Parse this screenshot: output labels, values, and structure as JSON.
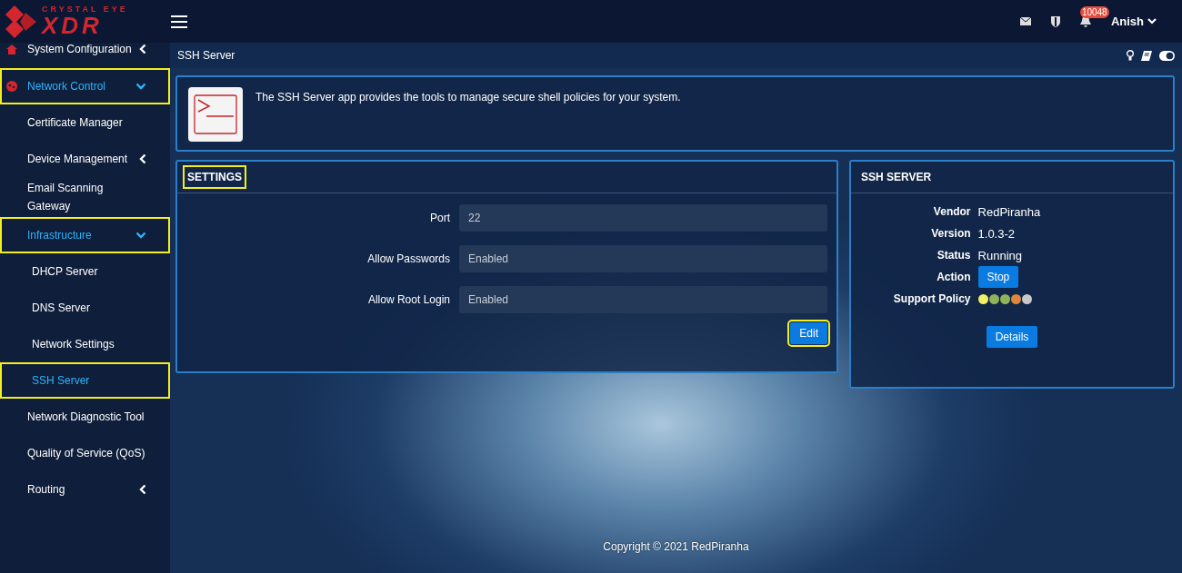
{
  "header": {
    "logo_top": "CRYSTAL EYE",
    "logo_main": "XDR",
    "notification_count": "10048",
    "user": "Anish"
  },
  "sidebar": {
    "items": [
      {
        "label": "System Configuration",
        "kind": "home",
        "expanded": false,
        "highlighted": false
      },
      {
        "label": "Network Control",
        "kind": "network",
        "expanded": true,
        "highlighted": true,
        "children": [
          {
            "label": "Certificate Manager",
            "selected": false,
            "highlighted": false
          },
          {
            "label": "Device Management",
            "expanded": false,
            "highlighted": false
          },
          {
            "label": "Email Scanning Gateway",
            "selected": false,
            "highlighted": false
          },
          {
            "label": "Infrastructure",
            "expanded": true,
            "highlighted": true,
            "children": [
              {
                "label": "DHCP Server",
                "selected": false,
                "highlighted": false
              },
              {
                "label": "DNS Server",
                "selected": false,
                "highlighted": false
              },
              {
                "label": "Network Settings",
                "selected": false,
                "highlighted": false
              },
              {
                "label": "SSH Server",
                "selected": true,
                "highlighted": true
              }
            ]
          },
          {
            "label": "Network Diagnostic Tool",
            "selected": false,
            "highlighted": false
          },
          {
            "label": "Quality of Service (QoS)",
            "selected": false,
            "highlighted": false
          },
          {
            "label": "Routing",
            "expanded": false,
            "highlighted": false
          }
        ]
      }
    ]
  },
  "page_title": "SSH Server",
  "intro": "The SSH Server app provides the tools to manage secure shell policies for your system.",
  "settings": {
    "title": "SETTINGS",
    "title_highlighted": true,
    "fields": [
      {
        "label": "Port",
        "value": "22"
      },
      {
        "label": "Allow Passwords",
        "value": "Enabled"
      },
      {
        "label": "Allow Root Login",
        "value": "Enabled"
      }
    ],
    "edit_button": {
      "label": "Edit",
      "highlighted": true
    }
  },
  "ssh_server": {
    "title": "SSH SERVER",
    "vendor_label": "Vendor",
    "vendor": "RedPiranha",
    "version_label": "Version",
    "version": "1.0.3-2",
    "status_label": "Status",
    "status": "Running",
    "action_label": "Action",
    "action_button": "Stop",
    "support_label": "Support Policy",
    "support_dots": [
      {
        "color": "#f2f062"
      },
      {
        "color": "#8fb35a"
      },
      {
        "color": "#8fb35a"
      },
      {
        "color": "#e0863a"
      },
      {
        "color": "#c8c8c8"
      }
    ],
    "details_button": "Details"
  },
  "footer": "Copyright © 2021 RedPiranha"
}
